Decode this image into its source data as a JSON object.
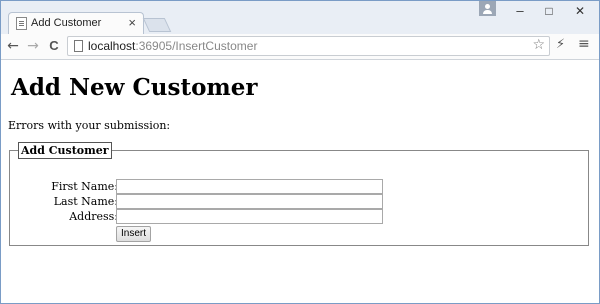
{
  "browser": {
    "tab_title": "Add Customer",
    "tab_close": "×",
    "window_controls": {
      "minimize": "–",
      "maximize": "□",
      "close": "✕"
    },
    "nav": {
      "back": "←",
      "forward": "→",
      "reload": "C"
    },
    "address": {
      "host": "localhost",
      "rest": ":36905/InsertCustomer"
    }
  },
  "page": {
    "heading": "Add New Customer",
    "error_message": "Errors with your submission:",
    "fieldset_legend": "Add Customer",
    "fields": [
      {
        "label": "First Name:",
        "value": ""
      },
      {
        "label": "Last Name:",
        "value": ""
      },
      {
        "label": "Address:",
        "value": ""
      }
    ],
    "submit_label": "Insert"
  }
}
